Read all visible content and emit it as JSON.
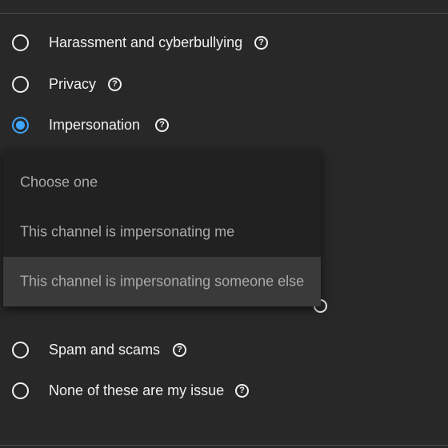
{
  "options": [
    {
      "label": "Harassment and cyberbullying",
      "checked": false
    },
    {
      "label": "Privacy",
      "checked": false
    },
    {
      "label": "Impersonation",
      "checked": true
    },
    {
      "label": "Spam and scams",
      "checked": false
    },
    {
      "label": "None of these are my issue",
      "checked": false
    }
  ],
  "help_icon": "question-circle-icon",
  "dropdown": {
    "items": [
      {
        "label": "Choose one"
      },
      {
        "label": "This channel is impersonating me"
      },
      {
        "label": "This channel is impersonating someone else",
        "highlighted": true
      }
    ]
  },
  "colors": {
    "background": "#282828",
    "accent": "#3ea6ff",
    "dropdown_bg": "#212121",
    "dropdown_hover": "#3a3a3a",
    "text": "#f1f1f1",
    "muted_text": "#aaaaaa"
  }
}
